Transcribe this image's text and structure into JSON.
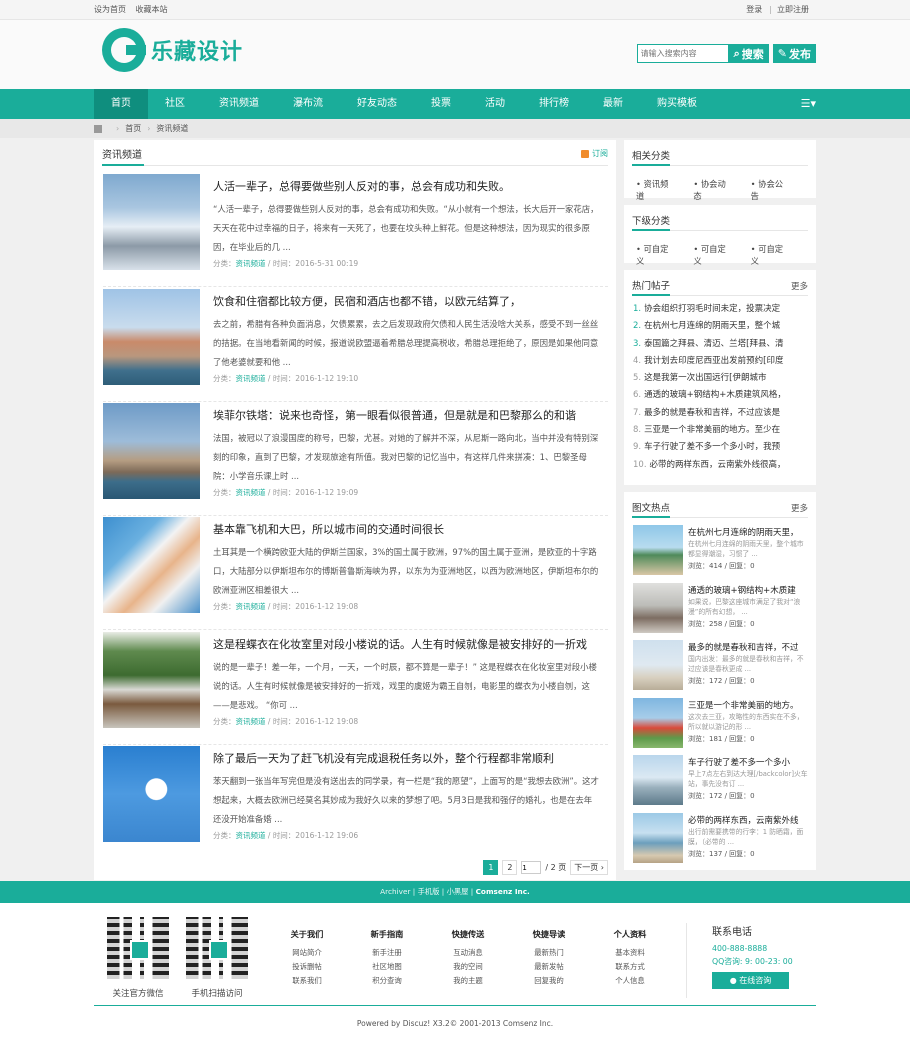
{
  "topbar": {
    "left": [
      "设为首页",
      "收藏本站"
    ],
    "right": [
      "登录",
      "立即注册"
    ]
  },
  "logo": {
    "text": "乐藏设计"
  },
  "search": {
    "placeholder": "请输入搜索内容",
    "search_label": "搜索",
    "post_label": "发布"
  },
  "nav": [
    "首页",
    "社区",
    "资讯频道",
    "瀑布流",
    "好友动态",
    "投票",
    "活动",
    "排行榜",
    "最新",
    "购买模板"
  ],
  "breadcrumb": [
    "首页",
    "资讯频道"
  ],
  "main": {
    "title": "资讯频道",
    "subscribe": "订阅"
  },
  "articles": [
    {
      "title": "人活一辈子，总得要做些别人反对的事，总会有成功和失败。",
      "summary": "“人活一辈子，总得要做些别人反对的事，总会有成功和失败。“从小就有一个想法，长大后开一家花店，天天在花中过幸福的日子，将来有一天死了，也要在坟头种上鲜花。但是这种想法，因为现实的很多原因，在毕业后的几 ...",
      "cat": "资讯频道",
      "time": "时间：2016-5-31 00:19"
    },
    {
      "title": "饮食和住宿都比较方便，民宿和酒店也都不错，以欧元结算了，",
      "summary": "去之前，希腊有各种负面消息，欠债累累，去之后发现政府欠债和人民生活没啥大关系，感受不到一丝丝的拮据。在当地看新闻的时候，报道说欧盟逼着希腊总理提高税收，希腊总理拒绝了，原因是如果他同意了他老婆就要和他 ...",
      "cat": "资讯频道",
      "time": "时间：2016-1-12 19:10"
    },
    {
      "title": "埃菲尔铁塔：说来也奇怪，第一眼看似很普通，但是就是和巴黎那么的和谐",
      "summary": "法国，被冠以了浪漫国度的称号，巴黎，尤甚。对她的了解并不深，从尼斯一路向北，当中并没有特别深刻的印象，直到了巴黎，才发现旅途有所值。我对巴黎的记忆当中，有这样几件来拼凑：1、巴黎圣母院：小学音乐课上时 ...",
      "cat": "资讯频道",
      "time": "时间：2016-1-12 19:09"
    },
    {
      "title": "基本靠飞机和大巴，所以城市间的交通时间很长",
      "summary": "土耳其是一个横跨欧亚大陆的伊斯兰国家，3%的国土属于欧洲，97%的国土属于亚洲，是欧亚的十字路口，大陆部分以伊斯坦布尔的博斯普鲁斯海峡为界，以东为为亚洲地区，以西为欧洲地区，伊斯坦布尔的欧洲亚洲区相差很大 ...",
      "cat": "资讯频道",
      "time": "时间：2016-1-12 19:08"
    },
    {
      "title": "这是程蝶衣在化妆室里对段小楼说的话。人生有时候就像是被安排好的一折戏",
      "summary": "说的是一辈子！差一年，一个月，一天，一个时辰，都不算是一辈子！” 这是程蝶衣在化妆室里对段小楼说的话。人生有时候就像是被安排好的一折戏，戏里的虞姬为霸王自刎，电影里的蝶衣为小楼自刎，这——是悲戏。 “你可 ...",
      "cat": "资讯频道",
      "time": "时间：2016-1-12 19:08"
    },
    {
      "title": "除了最后一天为了赶飞机没有完成退税任务以外，整个行程都非常顺利",
      "summary": "苯天翻到一张当年写完但是没有送出去的同学录，有一栏是“我的愿望”，上面写的是“我想去欧洲”。这才想起来，大概去欧洲已经莫名其妙成为我好久以来的梦想了吧。5月3日是我和强仔的婚礼，也是在去年还没开始准备婚 ...",
      "cat": "资讯频道",
      "time": "时间：2016-1-12 19:06"
    }
  ],
  "meta": {
    "cat_prefix": "分类：",
    "sep": "/"
  },
  "pager": {
    "pages": [
      "1",
      "2"
    ],
    "input": "1",
    "total": "/ 2 页",
    "next": "下一页 ›"
  },
  "related": {
    "title": "相关分类",
    "items": [
      "资讯频道",
      "协会动态",
      "协会公告"
    ]
  },
  "sub": {
    "title": "下级分类",
    "items": [
      "可自定义",
      "可自定义",
      "可自定义"
    ]
  },
  "hot": {
    "title": "热门帖子",
    "more": "更多",
    "items": [
      "协会组织打羽毛时间未定，投票决定",
      "在杭州七月连绵的阴雨天里，整个城",
      "泰国篇之拜县、清迈、兰塔[拜县、清",
      "我计划去印度尼西亚出发前预约[印度",
      "这是我第一次出国远行[伊朗城市",
      "通透的玻璃+钢结构+木质建筑风格，",
      "最多的就是春秋和吉祥，不过应该是",
      "三亚是一个非常美丽的地方。至少在",
      "车子行驶了差不多一个多小时，我预",
      "必带的两样东西，云南紫外线很高，"
    ]
  },
  "pics": {
    "title": "图文热点",
    "more": "更多",
    "items": [
      {
        "title": "在杭州七月连绵的阴雨天里，",
        "summary": "在杭州七月连绵的阴雨天里，整个城市都显得潮湿，习惯了 ...",
        "meta": "浏览：414 / 回复：0"
      },
      {
        "title": "通透的玻璃+钢结构+木质建",
        "summary": "如果说，巴黎这座城市满足了我对“浪漫”的所有幻想， ...",
        "meta": "浏览：258 / 回复：0"
      },
      {
        "title": "最多的就是春秋和吉祥，不过",
        "summary": "国内出发：最多的就是春秋和吉祥，不过应该是春秋更成 ...",
        "meta": "浏览：172 / 回复：0"
      },
      {
        "title": "三亚是一个非常美丽的地方。",
        "summary": "这次去三亚，攻略性的东西实在不多，所以就以游记的形 ...",
        "meta": "浏览：181 / 回复：0"
      },
      {
        "title": "车子行驶了差不多一个多小",
        "summary": "早上7点左右到达大理[/backcolor]火车站，事先没有订 ...",
        "meta": "浏览：172 / 回复：0"
      },
      {
        "title": "必带的两样东西，云南紫外线",
        "summary": "出行前需要携带的行李：1 防晒霜，面膜，（必带的 ...",
        "meta": "浏览：137 / 回复：0"
      }
    ]
  },
  "band": {
    "left": "Archiver",
    "mid1": "手机版",
    "mid2": "小黑屋",
    "brand": "Comsenz Inc."
  },
  "footer": {
    "qr": [
      "关注官方微信",
      "手机扫描访问"
    ],
    "cols": [
      {
        "h": "关于我们",
        "l": [
          "网站简介",
          "投诉删帖",
          "联系我们"
        ]
      },
      {
        "h": "新手指南",
        "l": [
          "新手注册",
          "社区地图",
          "积分查询"
        ]
      },
      {
        "h": "快捷传送",
        "l": [
          "互动消息",
          "我的空间",
          "我的主题"
        ]
      },
      {
        "h": "快捷导读",
        "l": [
          "最新热门",
          "最新发帖",
          "回复我的"
        ]
      },
      {
        "h": "个人资料",
        "l": [
          "基本资料",
          "联系方式",
          "个人信息"
        ]
      }
    ],
    "contact": {
      "title": "联系电话",
      "tel": "400-888-8888",
      "qq": "QQ咨询: 9: 00-23: 00",
      "btn": "在线咨询"
    },
    "powered": "Powered by Discuz! X3.2© 2001-2013 Comsenz Inc."
  },
  "colors": {
    "accent": "#1aad9a"
  }
}
